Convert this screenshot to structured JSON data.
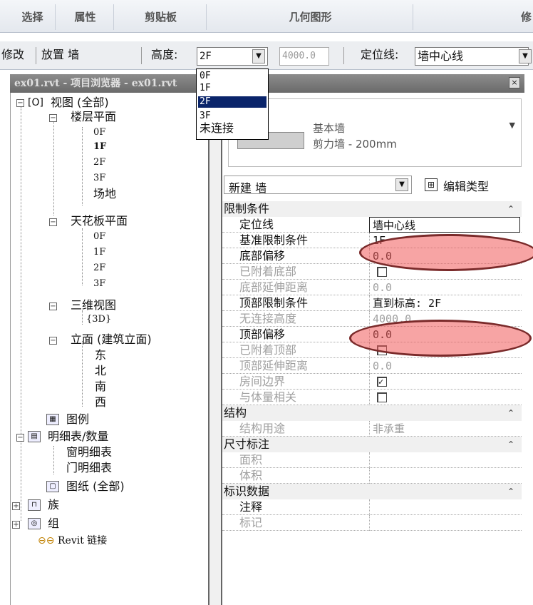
{
  "ribbon": {
    "tabs": [
      "选择",
      "属性",
      "剪贴板",
      "几何图形",
      "修"
    ]
  },
  "options": {
    "modify": "修改",
    "place": "放置 墙",
    "height_label": "高度:",
    "height_value": "2F",
    "height_num": "4000.0",
    "location_label": "定位线:",
    "location_value": "墙中心线"
  },
  "dropdown": {
    "items": [
      "0F",
      "1F",
      "2F",
      "3F",
      "未连接"
    ],
    "selected": "2F"
  },
  "browser": {
    "title": "ex01.rvt - 项目浏览器 - ex01.rvt",
    "views": "视图 (全部)",
    "floor_plans": "楼层平面",
    "fp": [
      "0F",
      "1F",
      "2F",
      "3F",
      "场地"
    ],
    "fp_bold": "1F",
    "ceiling": "天花板平面",
    "cp": [
      "0F",
      "1F",
      "2F",
      "3F"
    ],
    "threed": "三维视图",
    "td": [
      "{3D}"
    ],
    "elev": "立面 (建筑立面)",
    "el": [
      "东",
      "北",
      "南",
      "西"
    ],
    "legend": "图例",
    "schedules": "明细表/数量",
    "sc": [
      "窗明细表",
      "门明细表"
    ],
    "sheets": "图纸 (全部)",
    "families": "族",
    "groups": "组",
    "links": "Revit 链接"
  },
  "props": {
    "type_family": "基本墙",
    "type_name": "剪力墙 - 200mm",
    "instance": "新建 墙",
    "edit_type": "编辑类型",
    "groups": [
      {
        "name": "限制条件",
        "rows": [
          {
            "k": "定位线",
            "v": "墙中心线",
            "gray": false
          },
          {
            "k": "基准限制条件",
            "v": "1F",
            "gray": false
          },
          {
            "k": "底部偏移",
            "v": "0.0",
            "gray": false
          },
          {
            "k": "已附着底部",
            "v": "",
            "cb": false,
            "gray": true
          },
          {
            "k": "底部延伸距离",
            "v": "0.0",
            "gray": true
          },
          {
            "k": "顶部限制条件",
            "v": "直到标高: 2F",
            "gray": false
          },
          {
            "k": "无连接高度",
            "v": "4000.0",
            "gray": true
          },
          {
            "k": "顶部偏移",
            "v": "0.0",
            "gray": false
          },
          {
            "k": "已附着顶部",
            "v": "",
            "cb": false,
            "gray": true
          },
          {
            "k": "顶部延伸距离",
            "v": "0.0",
            "gray": true
          },
          {
            "k": "房间边界",
            "v": "",
            "cb": true,
            "gray": true
          },
          {
            "k": "与体量相关",
            "v": "",
            "cb": false,
            "gray": true
          }
        ]
      },
      {
        "name": "结构",
        "rows": [
          {
            "k": "结构用途",
            "v": "非承重",
            "gray": true
          }
        ]
      },
      {
        "name": "尺寸标注",
        "rows": [
          {
            "k": "面积",
            "v": "",
            "gray": true
          },
          {
            "k": "体积",
            "v": "",
            "gray": true
          }
        ]
      },
      {
        "name": "标识数据",
        "rows": [
          {
            "k": "注释",
            "v": "",
            "gray": false
          },
          {
            "k": "标记",
            "v": "",
            "gray": true
          }
        ]
      }
    ]
  }
}
